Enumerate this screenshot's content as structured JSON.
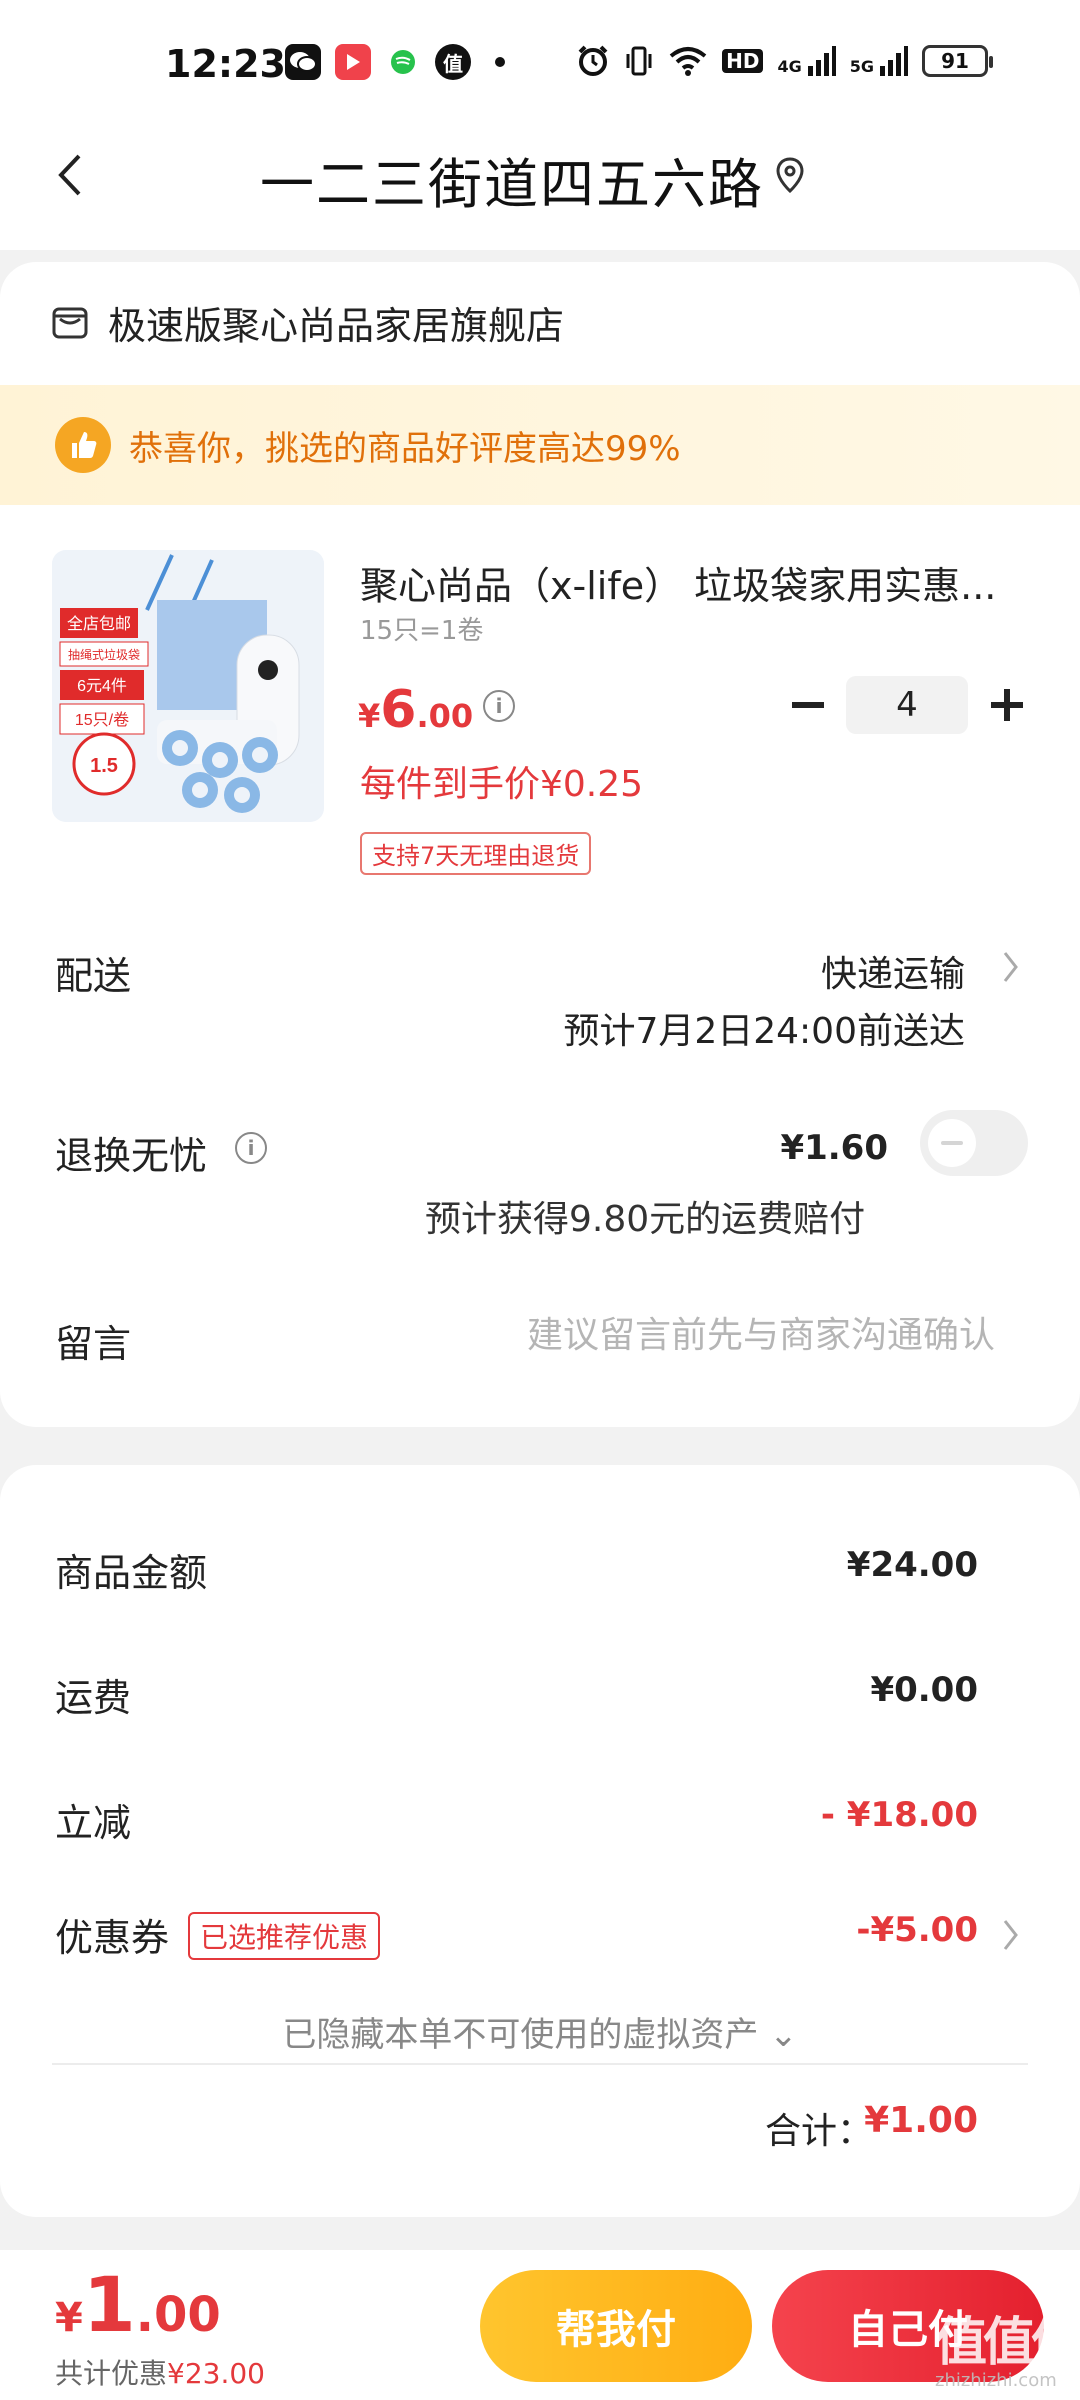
{
  "status_bar": {
    "time": "12:23",
    "network_1": "4G",
    "network_2": "5G",
    "hd": "HD",
    "battery": "91"
  },
  "header": {
    "title": "一二三街道四五六路"
  },
  "store": {
    "name": "极速版聚心尚品家居旗舰店"
  },
  "promo_banner": {
    "text": "恭喜你，挑选的商品好评度高达99%"
  },
  "product": {
    "title": "聚心尚品（x-life） 垃圾袋家用实惠...",
    "spec": "15只=1卷",
    "price_currency": "¥",
    "price_int": "6",
    "price_dec": ".00",
    "unit_price": "每件到手价¥0.25",
    "return_tag": "支持7天无理由退货",
    "quantity": "4",
    "image_badges": [
      "全店包邮",
      "抽绳式垃圾袋",
      "6元4件",
      "15只/卷",
      "1.5"
    ]
  },
  "delivery": {
    "label": "配送",
    "method": "快递运输",
    "eta": "预计7月2日24:00前送达"
  },
  "worry_free": {
    "label": "退换无忧",
    "price": "¥1.60",
    "note": "预计获得9.80元的运费赔付"
  },
  "message": {
    "label": "留言",
    "placeholder": "建议留言前先与商家沟通确认"
  },
  "summary": {
    "goods_label": "商品金额",
    "goods_value": "¥24.00",
    "shipping_label": "运费",
    "shipping_value": "¥0.00",
    "discount_label": "立减",
    "discount_value": "- ¥18.00",
    "coupon_label": "优惠券",
    "coupon_tag": "已选推荐优惠",
    "coupon_value": "-¥5.00",
    "hidden_assets": "已隐藏本单不可使用的虚拟资产 ⌄",
    "total_label": "合计：",
    "total_value": "¥1.00"
  },
  "bottom": {
    "price_currency": "¥",
    "price_int": "1",
    "price_dec": ".00",
    "savings_label": "共计优惠",
    "savings_value": "¥23.00",
    "help_pay": "帮我付",
    "self_pay": "自己付"
  },
  "watermark": {
    "text": "值值值",
    "sub": "zhizhizhi.com"
  },
  "colors": {
    "accent_red": "#e4393c",
    "promo_orange": "#e0700a",
    "help_yellow": "#ffb81c"
  }
}
